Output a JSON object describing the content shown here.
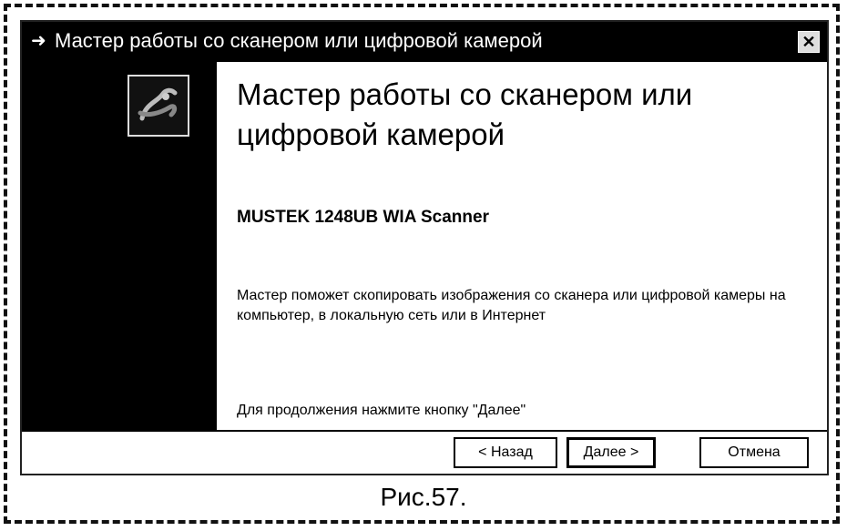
{
  "window": {
    "title": "Мастер работы со сканером или цифровой камерой",
    "close_label": "✕"
  },
  "content": {
    "heading": "Мастер работы со сканером или цифровой камерой",
    "device": "MUSTEK 1248UB WIA Scanner",
    "description": "Мастер поможет скопировать изображения со сканера или цифровой камеры на компьютер, в локальную сеть или в Интернет",
    "hint": "Для продолжения нажмите кнопку \"Далее\""
  },
  "buttons": {
    "back": "< Назад",
    "next": "Далее >",
    "cancel": "Отмена"
  },
  "caption": "Рис.57."
}
